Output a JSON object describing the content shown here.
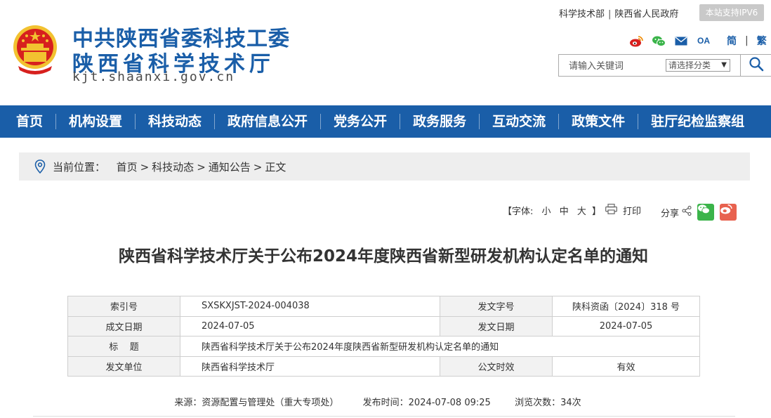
{
  "header": {
    "org_name": "中共陕西省委科技工委",
    "dept_name": "陕西省科学技术厅",
    "domain": "kjt.shaanxi.gov.cn",
    "top_links": [
      "科学技术部",
      "陕西省人民政府"
    ],
    "top_links_sep": "|",
    "ipv6_badge": "本站支持IPV6",
    "lang_simplified": "简",
    "lang_traditional": "繁",
    "lang_sep": "|",
    "social_icons": [
      "weibo-icon",
      "wechat-icon",
      "mail-icon",
      "oa-icon"
    ],
    "oa_label": "OA",
    "search": {
      "placeholder": "请输入关键词",
      "category_selected": "请选择分类",
      "category_arrow": "▼"
    }
  },
  "nav": {
    "items": [
      "首页",
      "机构设置",
      "科技动态",
      "政府信息公开",
      "党务公开",
      "政务服务",
      "互动交流",
      "政策文件",
      "驻厅纪检监察组"
    ]
  },
  "breadcrumb": {
    "label": "当前位置：",
    "items": [
      "首页",
      "科技动态",
      "通知公告",
      "正文"
    ],
    "sep": ">"
  },
  "tools": {
    "font_open": "【字体:",
    "font_small": "小",
    "font_medium": "中",
    "font_large": "大",
    "font_close": "】",
    "print_label": "打印",
    "share_label": "分享"
  },
  "article": {
    "title": "陕西省科学技术厅关于公布2024年度陕西省新型研发机构认定名单的通知",
    "meta": {
      "index_label": "索引号",
      "index_value": "SXSKXJST-2024-004038",
      "doc_no_label": "发文字号",
      "doc_no_value": "陕科资函〔2024〕318 号",
      "written_date_label": "成文日期",
      "written_date_value": "2024-07-05",
      "issue_date_label": "发文日期",
      "issue_date_value": "2024-07-05",
      "title_label": "标    题",
      "title_value": "陕西省科学技术厅关于公布2024年度陕西省新型研发机构认定名单的通知",
      "issuer_label": "发文单位",
      "issuer_value": "陕西省科学技术厅",
      "validity_label": "公文时效",
      "validity_value": "有效"
    },
    "source_label": "来源：",
    "source_value": "资源配置与管理处（重大专项处）",
    "publish_label": "发布时间：",
    "publish_value": "2024-07-08 09:25",
    "views_label": "浏览次数：",
    "views_value": "34次"
  },
  "colors": {
    "brand_blue": "#1a5ea8",
    "emblem_red": "#d7201e",
    "emblem_gold": "#f2c230",
    "wechat_green": "#3bb44a",
    "weibo_red": "#e8624f"
  }
}
